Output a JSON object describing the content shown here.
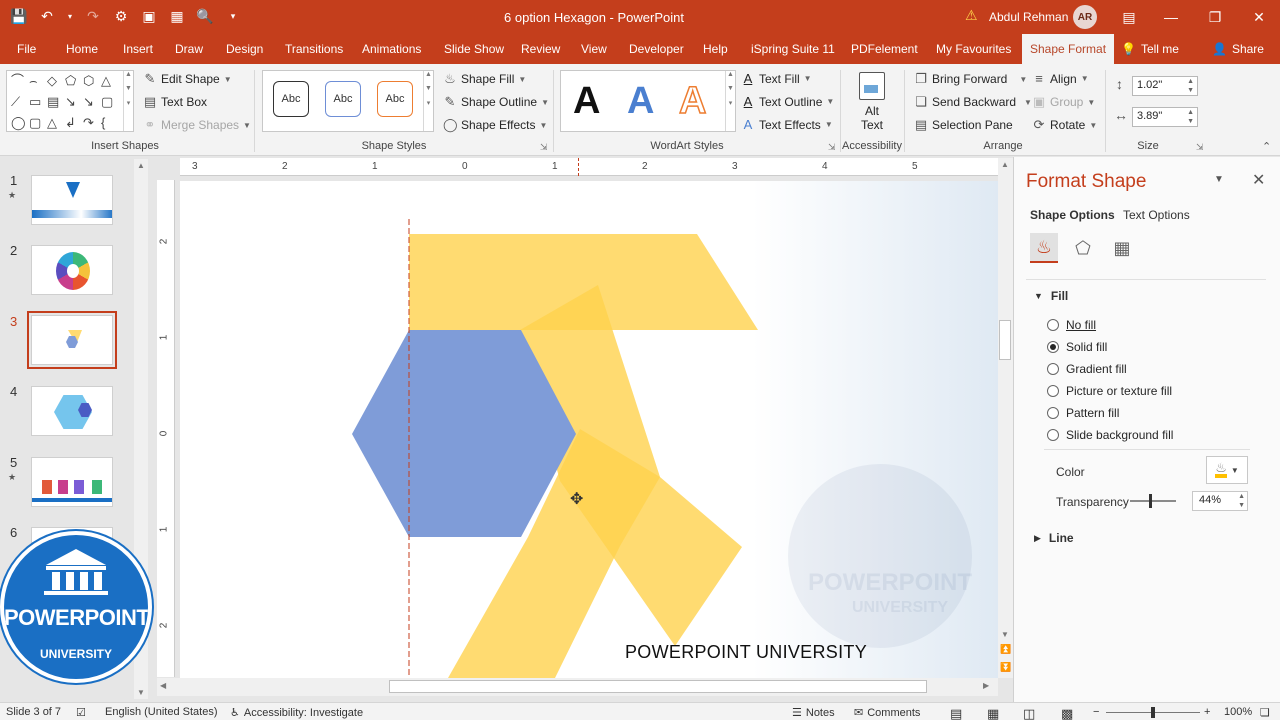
{
  "titlebar": {
    "doc_title": "6 option Hexagon  -  PowerPoint",
    "user_name": "Abdul Rehman",
    "user_initials": "AR"
  },
  "tabs": [
    "File",
    "Home",
    "Insert",
    "Draw",
    "Design",
    "Transitions",
    "Animations",
    "Slide Show",
    "Review",
    "View",
    "Developer",
    "Help",
    "iSpring Suite 11",
    "PDFelement",
    "My Favourites",
    "Shape Format"
  ],
  "tellme": "Tell me",
  "share": "Share",
  "ribbon": {
    "insert_shapes": {
      "label": "Insert Shapes",
      "edit_shape": "Edit Shape",
      "text_box": "Text Box",
      "merge_shapes": "Merge Shapes"
    },
    "shape_styles": {
      "label": "Shape Styles",
      "preset": "Abc",
      "shape_fill": "Shape Fill",
      "shape_outline": "Shape Outline",
      "shape_effects": "Shape Effects"
    },
    "wordart": {
      "label": "WordArt Styles",
      "letter": "A",
      "text_fill": "Text Fill",
      "text_outline": "Text Outline",
      "text_effects": "Text Effects"
    },
    "accessibility": {
      "label": "Accessibility",
      "alt_text": "Alt Text"
    },
    "arrange": {
      "label": "Arrange",
      "bring_forward": "Bring Forward",
      "send_backward": "Send Backward",
      "selection_pane": "Selection Pane",
      "align": "Align",
      "group": "Group",
      "rotate": "Rotate"
    },
    "size": {
      "label": "Size",
      "height": "1.02\"",
      "width": "3.89\""
    }
  },
  "slides": [
    {
      "num": "1",
      "star": "★"
    },
    {
      "num": "2",
      "star": ""
    },
    {
      "num": "3",
      "star": ""
    },
    {
      "num": "4",
      "star": ""
    },
    {
      "num": "5",
      "star": "★"
    },
    {
      "num": "6",
      "star": ""
    }
  ],
  "rulers": {
    "h": [
      "3",
      "2",
      "1",
      "0",
      "1",
      "2",
      "3",
      "4",
      "5"
    ],
    "v": [
      "2",
      "1",
      "0",
      "1",
      "2"
    ]
  },
  "slide": {
    "footer_text": "POWERPOINT UNIVERSITY",
    "watermark_top": "POWERPOINT",
    "watermark_bottom": "UNIVERSITY"
  },
  "format_pane": {
    "title": "Format Shape",
    "tab_shape": "Shape Options",
    "tab_text": "Text Options",
    "fill_section": "Fill",
    "fill_options": [
      "No fill",
      "Solid fill",
      "Gradient fill",
      "Picture or texture fill",
      "Pattern fill",
      "Slide background fill"
    ],
    "selected_fill": 1,
    "color_label": "Color",
    "transparency_label": "Transparency",
    "transparency_value": "44%",
    "transparency_fraction": 0.44,
    "line_section": "Line"
  },
  "statusbar": {
    "slide_info": "Slide 3 of 7",
    "language": "English (United States)",
    "accessibility": "Accessibility: Investigate",
    "notes": "Notes",
    "comments": "Comments",
    "zoom": "100%"
  },
  "logo": {
    "top": "POWERPOINT",
    "bottom": "UNIVERSITY"
  },
  "colors": {
    "accent": "#c43e1c",
    "hexagon": "#7f9cd8",
    "chevron": "#ffd24d",
    "logo_blue": "#1a6fc4"
  }
}
